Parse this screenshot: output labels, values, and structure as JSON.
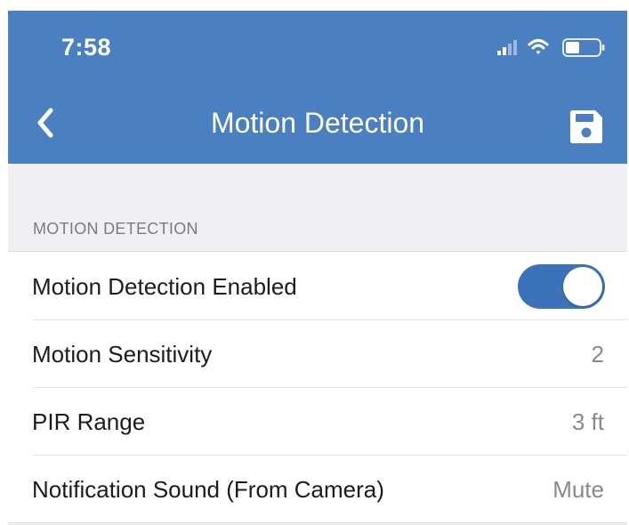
{
  "status_bar": {
    "time": "7:58",
    "icons": [
      "signal-icon",
      "wifi-icon",
      "battery-icon"
    ]
  },
  "nav": {
    "title": "Motion Detection",
    "back_icon": "chevron-left-icon",
    "save_icon": "floppy-disk-icon"
  },
  "section": {
    "header": "MOTION DETECTION"
  },
  "rows": [
    {
      "label": "Motion Detection Enabled",
      "toggle_on": true
    },
    {
      "label": "Motion Sensitivity",
      "value": "2"
    },
    {
      "label": "PIR Range",
      "value": "3 ft"
    },
    {
      "label": "Notification Sound (From Camera)",
      "value": "Mute"
    }
  ],
  "colors": {
    "nav_background": "#4a80c1",
    "toggle_on": "#3b72b9",
    "page_background": "#efeff4"
  }
}
